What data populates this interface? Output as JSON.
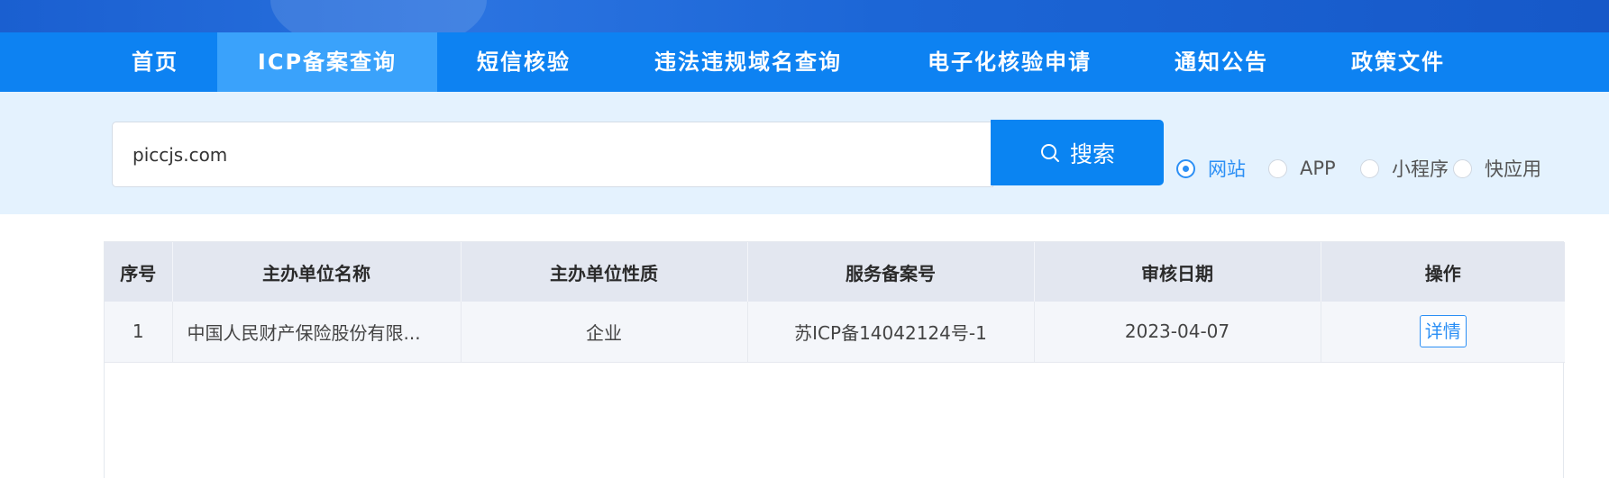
{
  "nav": {
    "items": [
      {
        "label": "首页"
      },
      {
        "label": "ICP备案查询"
      },
      {
        "label": "短信核验"
      },
      {
        "label": "违法违规域名查询"
      },
      {
        "label": "电子化核验申请"
      },
      {
        "label": "通知公告"
      },
      {
        "label": "政策文件"
      }
    ],
    "active_index": 1
  },
  "search": {
    "value": "piccjs.com",
    "button_label": "搜索",
    "button_icon": "search-icon"
  },
  "type_filter": {
    "options": [
      {
        "label": "网站",
        "checked": true
      },
      {
        "label": "APP",
        "checked": false
      },
      {
        "label": "小程序",
        "checked": false
      },
      {
        "label": "快应用",
        "checked": false
      }
    ]
  },
  "results": {
    "columns": [
      "序号",
      "主办单位名称",
      "主办单位性质",
      "服务备案号",
      "审核日期",
      "操作"
    ],
    "rows": [
      {
        "index": "1",
        "org_name": "中国人民财产保险股份有限...",
        "org_type": "企业",
        "record_no": "苏ICP备14042124号-1",
        "review_date": "2023-04-07",
        "action": "详情"
      }
    ]
  },
  "colors": {
    "nav_bg": "#0d82f2",
    "nav_active": "#3aa2fb",
    "accent": "#2b8ff5",
    "search_band": "#e4f2fe"
  }
}
